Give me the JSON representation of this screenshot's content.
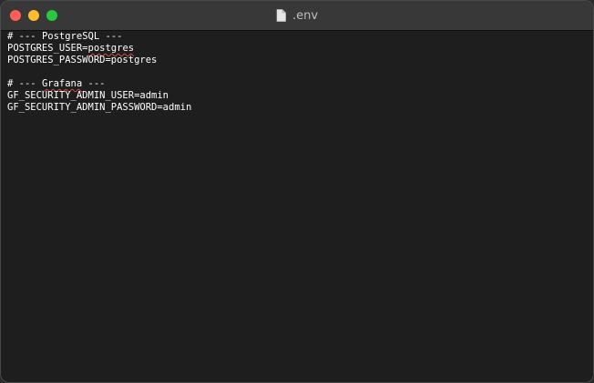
{
  "window": {
    "title": ".env",
    "title_icon": "document-icon",
    "buttons": [
      "close",
      "minimize",
      "zoom"
    ]
  },
  "colors": {
    "close": "#ff5f57",
    "minimize": "#febc2e",
    "zoom": "#28c840",
    "editor_bg": "#1e1e1e",
    "text": "#ffffff",
    "spell_underline": "#d24b4b"
  },
  "editor": {
    "lines": [
      {
        "pre": "# --- ",
        "mark": "",
        "post": "PostgreSQL ---"
      },
      {
        "pre": "POSTGRES_USER=",
        "mark": "postgres",
        "post": ""
      },
      {
        "pre": "POSTGRES_PASSWORD=postgres",
        "mark": "",
        "post": ""
      },
      {
        "pre": "",
        "mark": "",
        "post": ""
      },
      {
        "pre": "# --- ",
        "mark": "Grafana",
        "post": " ---"
      },
      {
        "pre": "GF_SECURITY_ADMIN_USER=admin",
        "mark": "",
        "post": ""
      },
      {
        "pre": "GF_SECURITY_ADMIN_PASSWORD=admin",
        "mark": "",
        "post": ""
      }
    ]
  }
}
